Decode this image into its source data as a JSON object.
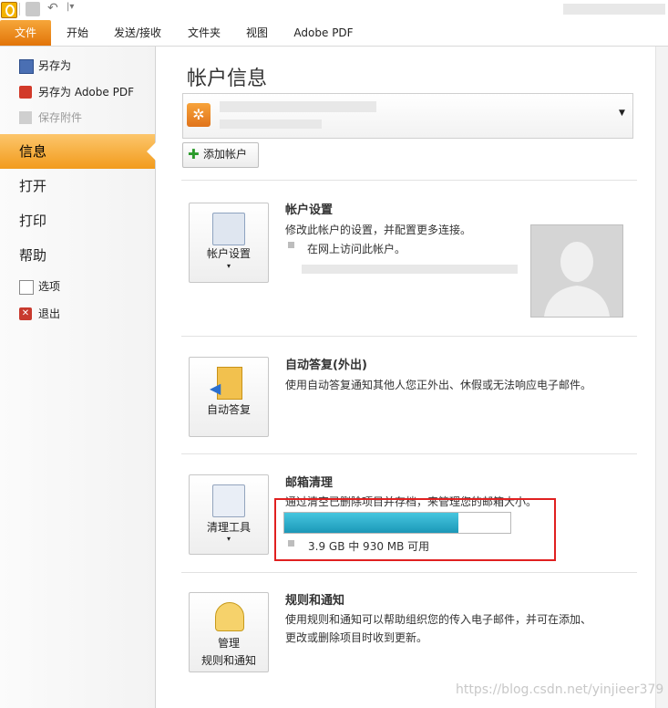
{
  "tabs": [
    "文件",
    "开始",
    "发送/接收",
    "文件夹",
    "视图",
    "Adobe PDF"
  ],
  "nav": {
    "small_top": [
      {
        "label": "另存为",
        "icon": "save-as-icon"
      },
      {
        "label": "另存为 Adobe PDF",
        "icon": "pdf-icon"
      },
      {
        "label": "保存附件",
        "icon": "attachment-icon"
      }
    ],
    "big": [
      "信息",
      "打开",
      "打印",
      "帮助"
    ],
    "small_bottom": [
      {
        "label": "选项",
        "icon": "options-icon"
      },
      {
        "label": "退出",
        "icon": "exit-icon"
      }
    ]
  },
  "main": {
    "title": "帐户信息",
    "add_account": "添加帐户",
    "sections": [
      {
        "button": "帐户设置",
        "title": "帐户设置",
        "desc": "修改此帐户的设置，并配置更多连接。",
        "bullet": "在网上访问此帐户。"
      },
      {
        "button": "自动答复",
        "title": "自动答复(外出)",
        "desc": "使用自动答复通知其他人您正外出、休假或无法响应电子邮件。"
      },
      {
        "button": "清理工具",
        "title": "邮箱清理",
        "desc": "通过清空已删除项目并存档，来管理您的邮箱大小。",
        "quota": "3.9 GB 中 930 MB 可用",
        "quota_fraction": 0.77
      },
      {
        "button_line1": "管理",
        "button_line2": "规则和通知",
        "title": "规则和通知",
        "desc1": "使用规则和通知可以帮助组织您的传入电子邮件，并可在添加、",
        "desc2": "更改或删除项目时收到更新。"
      }
    ]
  },
  "watermark": "https://blog.csdn.net/yinjieer379",
  "colors": {
    "accent": "#f29b1d",
    "quota": "#1fa0c0",
    "highlight": "#e02020"
  }
}
